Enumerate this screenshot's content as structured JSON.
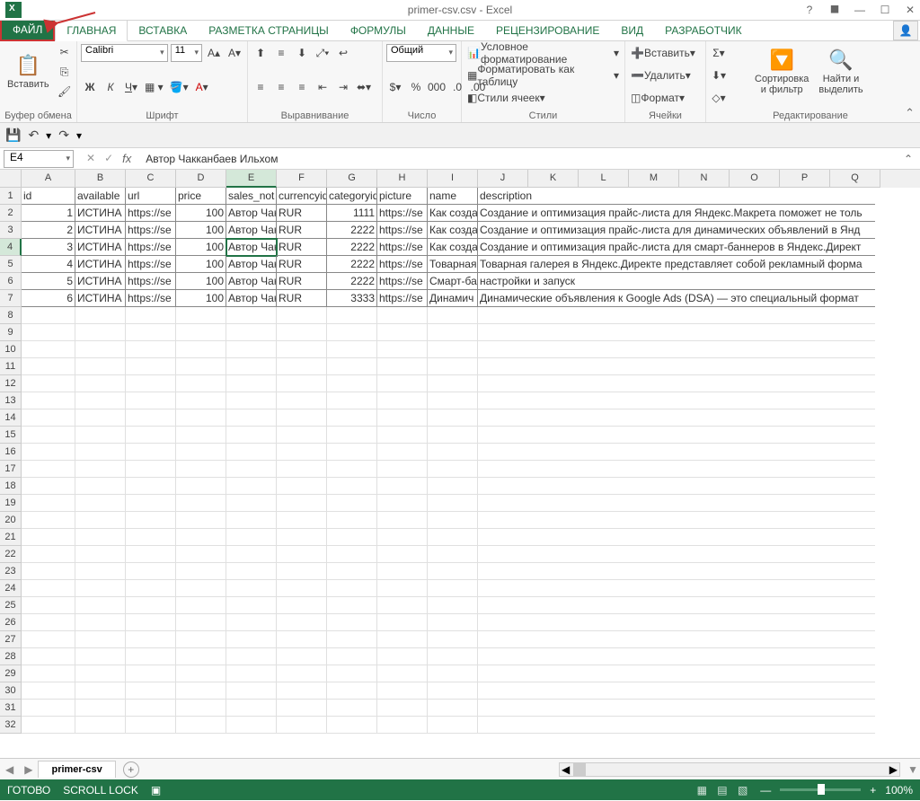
{
  "app": {
    "title": "primer-csv.csv - Excel"
  },
  "window_controls": {
    "help": "?",
    "ribbon_opts": "⯀",
    "min": "—",
    "max": "☐",
    "close": "✕"
  },
  "tabs": {
    "file": "ФАЙЛ",
    "home": "ГЛАВНАЯ",
    "insert": "ВСТАВКА",
    "layout": "РАЗМЕТКА СТРАНИЦЫ",
    "formulas": "ФОРМУЛЫ",
    "data": "ДАННЫЕ",
    "review": "РЕЦЕНЗИРОВАНИЕ",
    "view": "ВИД",
    "dev": "РАЗРАБОТЧИК"
  },
  "ribbon": {
    "clipboard": {
      "paste": "Вставить",
      "label": "Буфер обмена"
    },
    "font": {
      "name": "Calibri",
      "size": "11",
      "label": "Шрифт"
    },
    "align": {
      "label": "Выравнивание"
    },
    "number": {
      "format": "Общий",
      "label": "Число"
    },
    "styles": {
      "cond": "Условное форматирование",
      "table": "Форматировать как таблицу",
      "cell": "Стили ячеек",
      "label": "Стили"
    },
    "cells": {
      "insert": "Вставить",
      "delete": "Удалить",
      "format": "Формат",
      "label": "Ячейки"
    },
    "editing": {
      "sort": "Сортировка\nи фильтр",
      "find": "Найти и\nвыделить",
      "label": "Редактирование"
    }
  },
  "qat": {
    "save": "💾",
    "undo": "↶",
    "redo": "↷"
  },
  "namebox": "E4",
  "formula_bar": "Автор Чакканбаев Ильхом",
  "columns": [
    "A",
    "B",
    "C",
    "D",
    "E",
    "F",
    "G",
    "H",
    "I",
    "J",
    "K",
    "L",
    "M",
    "N",
    "O",
    "P",
    "Q"
  ],
  "headers": {
    "A": "id",
    "B": "available",
    "C": "url",
    "D": "price",
    "E": "sales_not",
    "F": "currencyid",
    "G": "categoryid",
    "H": "picture",
    "I": "name",
    "J": "description"
  },
  "rows": [
    {
      "A": "1",
      "B": "ИСТИНА",
      "C": "https://se",
      "D": "100",
      "E": "Автор Чак",
      "F": "RUR",
      "G": "1111",
      "H": "https://se",
      "I": "Как созда",
      "J": "Создание и оптимизация прайс-листа для Яндекс.Макрета поможет не толь"
    },
    {
      "A": "2",
      "B": "ИСТИНА",
      "C": "https://se",
      "D": "100",
      "E": "Автор Чак",
      "F": "RUR",
      "G": "2222",
      "H": "https://se",
      "I": "Как созда",
      "J": "Создание и оптимизация прайс-листа для динамических объявлений в Янд"
    },
    {
      "A": "3",
      "B": "ИСТИНА",
      "C": "https://se",
      "D": "100",
      "E": "Автор Чак",
      "F": "RUR",
      "G": "2222",
      "H": "https://se",
      "I": "Как созда",
      "J": "Создание и оптимизация прайс-листа для смарт-баннеров в Яндекс.Директ"
    },
    {
      "A": "4",
      "B": "ИСТИНА",
      "C": "https://se",
      "D": "100",
      "E": "Автор Чак",
      "F": "RUR",
      "G": "2222",
      "H": "https://se",
      "I": "Товарная",
      "J": "Товарная галерея в Яндекс.Директе представляет собой рекламный форма"
    },
    {
      "A": "5",
      "B": "ИСТИНА",
      "C": "https://se",
      "D": "100",
      "E": "Автор Чак",
      "F": "RUR",
      "G": "2222",
      "H": "https://se",
      "I": "Смарт-ба",
      "J": "настройки и запуск"
    },
    {
      "A": "6",
      "B": "ИСТИНА",
      "C": "https://se",
      "D": "100",
      "E": "Автор Чак",
      "F": "RUR",
      "G": "3333",
      "H": "https://se",
      "I": "Динамич",
      "J": "Динамические объявления к Google Ads (DSA) — это специальный формат"
    }
  ],
  "sheet": {
    "name": "primer-csv"
  },
  "status": {
    "ready": "ГОТОВО",
    "scroll": "SCROLL LOCK",
    "zoom": "100%"
  }
}
